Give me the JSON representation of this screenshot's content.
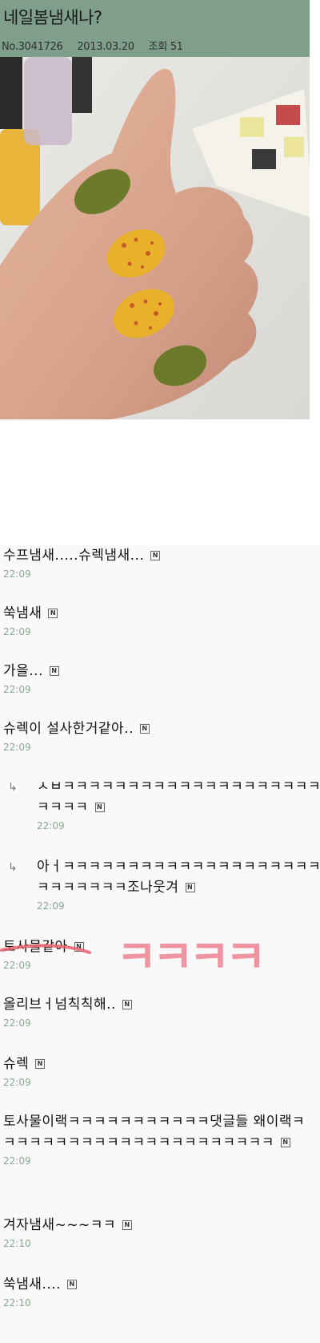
{
  "post": {
    "title": "네일봄냄새나?",
    "number": "No.3041726",
    "date": "2013.03.20",
    "views": "조회 51"
  },
  "photo": {
    "description_icon": "nail-photo"
  },
  "comments": [
    {
      "text": "수프냄새.....슈렉냄새...",
      "time": "22:09",
      "badge": "N"
    },
    {
      "text": "쑥냄새",
      "time": "22:09",
      "badge": "N"
    },
    {
      "text": "가을...",
      "time": "22:09",
      "badge": "N"
    },
    {
      "text": "슈렉이 설사한거같아..",
      "time": "22:09",
      "badge": "N"
    },
    {
      "text": "ㅅㅂㅋㅋㅋㅋㅋㅋㅋㅋㅋㅋㅋㅋㅋㅋㅋㅋㅋㅋㅋㅋㅋㅋㅋㅋ",
      "time": "22:09",
      "badge": "N",
      "reply": true
    },
    {
      "text": "아ㅓㅋㅋㅋㅋㅋㅋㅋㅋㅋㅋㅋㅋㅋㅋㅋㅋㅋㅋㅋㅋㅋㅋㅋㅋㅋㅋㅋ조나웃겨",
      "time": "22:09",
      "badge": "N",
      "reply": true
    },
    {
      "text": "토사물같아",
      "time": "22:09",
      "badge": "N"
    },
    {
      "text": "올리브ㅓ넘칙칙해..",
      "time": "22:09",
      "badge": "N"
    },
    {
      "text": "슈렉",
      "time": "22:09",
      "badge": "N"
    },
    {
      "text": "토사물이랙ㅋㅋㅋㅋㅋㅋㅋㅋㅋㅋㅋ댓글들 왜이랙ㅋㅋㅋㅋㅋㅋㅋㅋㅋㅋㅋㅋㅋㅋㅋㅋㅋㅋㅋㅋㅋㅋ",
      "time": "22:09",
      "badge": "N"
    },
    {
      "text": "겨자냄새~~~ㅋㅋ",
      "time": "22:10",
      "badge": "N"
    },
    {
      "text": "쑥냄새....",
      "time": "22:10",
      "badge": "N"
    }
  ],
  "reply_arrow": "↳",
  "scribble_text": "ㅋㅋㅋㅋ",
  "colors": {
    "header_bg": "#7f9f8c",
    "time": "#88a891",
    "scribble": "#f07c8c"
  }
}
